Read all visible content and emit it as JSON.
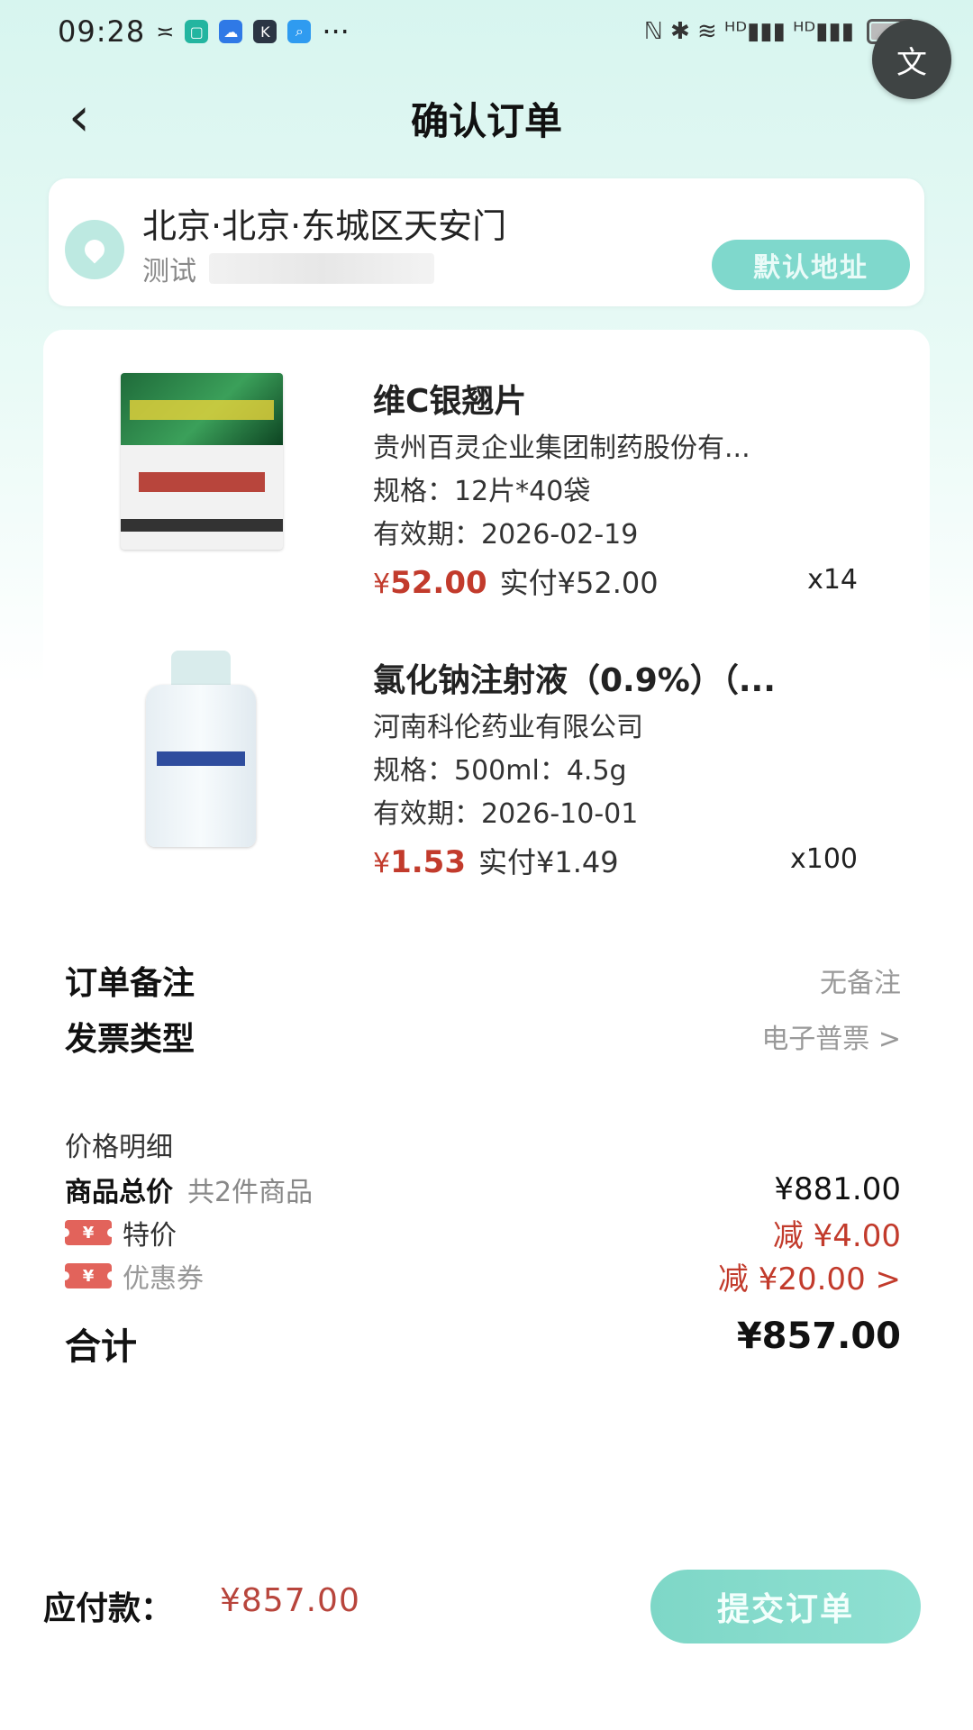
{
  "status_bar": {
    "time": "09:28",
    "more": "···",
    "right_icons": "ℕ ✱ ≋ ᴴᴰ▮▮▮ ᴴᴰ▮▮▮",
    "battery_level": 0.6
  },
  "header": {
    "title": "确认订单",
    "translate_icon": "文"
  },
  "address": {
    "line": "北京·北京·东城区天安门",
    "contact_name": "测试",
    "default_badge": "默认地址"
  },
  "products": [
    {
      "name": "维C银翘片",
      "manufacturer": "贵州百灵企业集团制药股份有...",
      "spec": "规格：12片*40袋",
      "expiry": "有效期：2026-02-19",
      "price_symbol": "¥",
      "price": "52.00",
      "actual_paid": "实付¥52.00",
      "quantity": "x14",
      "image_icon": "pill-pack"
    },
    {
      "name": "氯化钠注射液（0.9%）（...",
      "manufacturer": "河南科伦药业有限公司",
      "spec": "规格：500ml：4.5g",
      "expiry": "有效期：2026-10-01",
      "price_symbol": "¥",
      "price": "1.53",
      "actual_paid": "实付¥1.49",
      "quantity": "x100",
      "image_icon": "saline-bottle"
    }
  ],
  "order_remark": {
    "label": "订单备注",
    "value": "无备注"
  },
  "invoice": {
    "label": "发票类型",
    "value": "电子普票 >"
  },
  "price_detail": {
    "title": "价格明细",
    "goods_total_label": "商品总价",
    "goods_count": "共2件商品",
    "goods_total_value": "¥881.00",
    "special_label": "特价",
    "special_value": "减 ¥4.00",
    "coupon_label": "优惠券",
    "coupon_value": "减 ¥20.00 >",
    "tag_icon_text": "¥"
  },
  "summary": {
    "label": "合计",
    "value": "¥857.00"
  },
  "bottom_bar": {
    "pay_label": "应付款：",
    "pay_value": "¥857.00",
    "submit_label": "提交订单"
  },
  "colors": {
    "accent": "#7fd8cc",
    "price_red": "#c23b2c"
  }
}
